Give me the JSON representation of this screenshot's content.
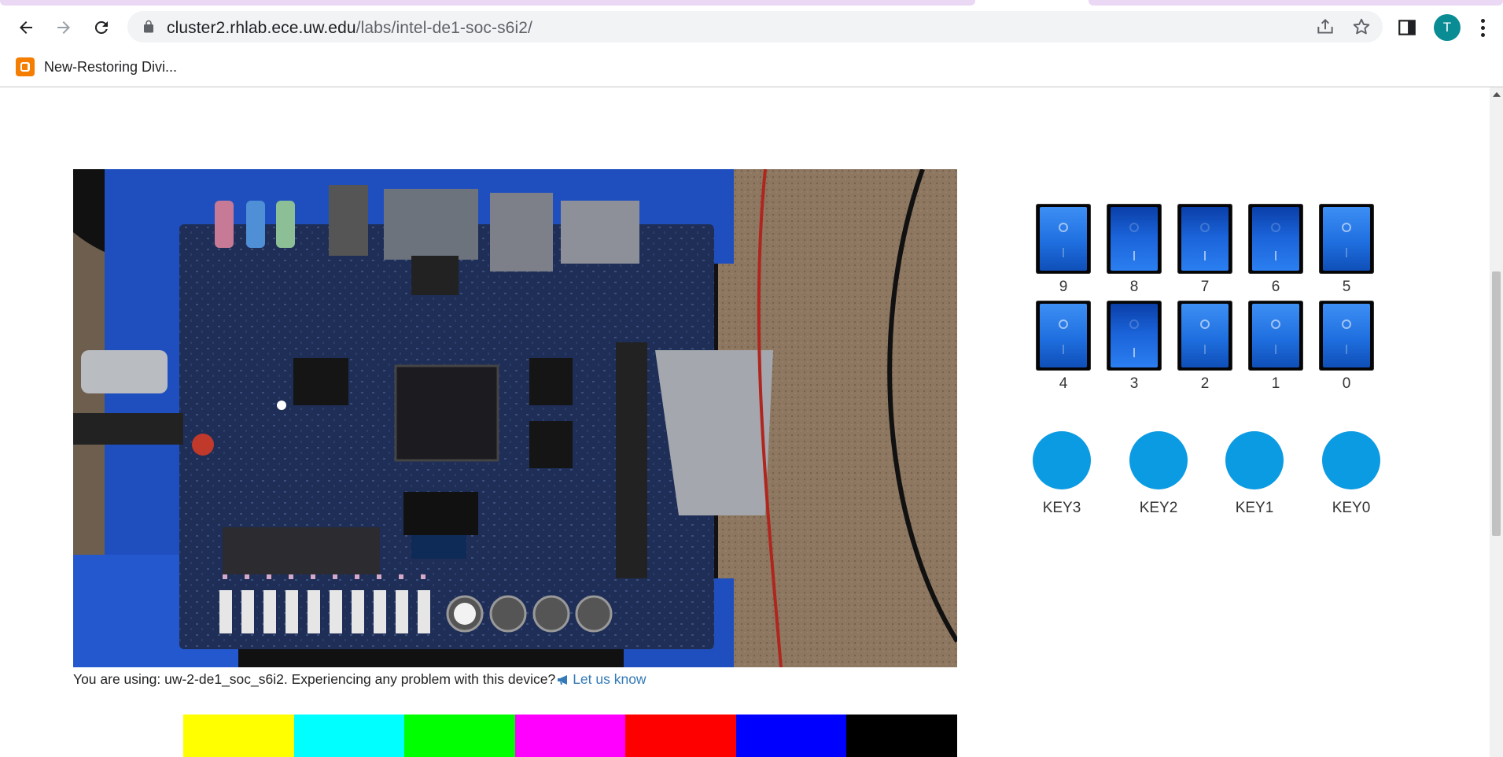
{
  "browser": {
    "url_host": "cluster2.rhlab.ece.uw.edu",
    "url_path": "/labs/intel-de1-soc-s6i2/",
    "avatar_letter": "T",
    "bookmark_label": "New-Restoring Divi..."
  },
  "status": {
    "text": "You are using: uw-2-de1_soc_s6i2. Experiencing any problem with this device?",
    "link": "Let us know"
  },
  "switches": [
    {
      "label": "9",
      "state": "off"
    },
    {
      "label": "8",
      "state": "on"
    },
    {
      "label": "7",
      "state": "on"
    },
    {
      "label": "6",
      "state": "on"
    },
    {
      "label": "5",
      "state": "off"
    },
    {
      "label": "4",
      "state": "off"
    },
    {
      "label": "3",
      "state": "on"
    },
    {
      "label": "2",
      "state": "off"
    },
    {
      "label": "1",
      "state": "off"
    },
    {
      "label": "0",
      "state": "off"
    }
  ],
  "keys": [
    {
      "label": "KEY3"
    },
    {
      "label": "KEY2"
    },
    {
      "label": "KEY1"
    },
    {
      "label": "KEY0"
    }
  ],
  "colors": {
    "key_button": "#0b9be3",
    "color_bar": [
      "#ffff00",
      "#00ffff",
      "#00ff00",
      "#ff00ff",
      "#ff0000",
      "#0000ff",
      "#000000"
    ]
  }
}
